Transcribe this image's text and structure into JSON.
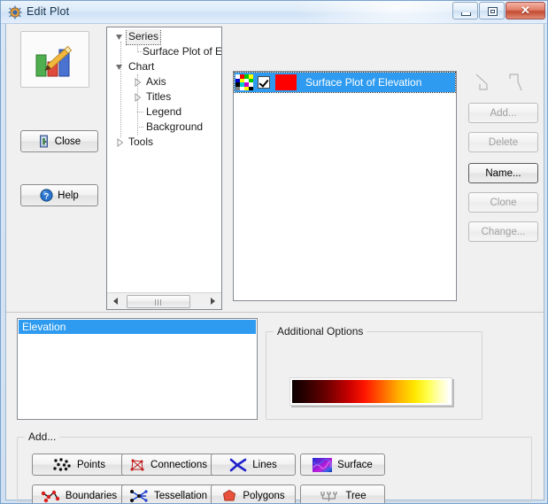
{
  "window": {
    "title": "Edit Plot",
    "icon": "plot-gear-icon",
    "controls": {
      "minimize": "minimize-button",
      "maximize": "maximize-button",
      "close": "✕"
    }
  },
  "left_panel": {
    "preview_icon": "chart-pencil-icon",
    "buttons": [
      {
        "label": "Close",
        "icon": "exit-door-icon",
        "enabled": true
      },
      {
        "label": "Help",
        "icon": "help-question-icon",
        "enabled": true
      }
    ]
  },
  "tree": {
    "nodes": [
      {
        "label": "Series",
        "level": 0,
        "state": "expanded",
        "selected": true
      },
      {
        "label": "Surface Plot of El",
        "level": 2,
        "state": "leaf",
        "selected": false
      },
      {
        "label": "Chart",
        "level": 0,
        "state": "expanded",
        "selected": false
      },
      {
        "label": "Axis",
        "level": 1,
        "state": "collapsed",
        "selected": false
      },
      {
        "label": "Titles",
        "level": 1,
        "state": "collapsed",
        "selected": false
      },
      {
        "label": "Legend",
        "level": 1,
        "state": "leaf",
        "selected": false
      },
      {
        "label": "Background",
        "level": 1,
        "state": "leaf",
        "selected": false
      },
      {
        "label": "Tools",
        "level": 0,
        "state": "collapsed",
        "selected": false
      }
    ],
    "scrollbar": {
      "left_arrow": "scroll-left-arrow-icon",
      "right_arrow": "scroll-right-arrow-icon"
    }
  },
  "series_list": {
    "rows": [
      {
        "palette_icon": "color-palette-icon",
        "visible_checked": true,
        "color_swatch": "#ff0000",
        "label": "Surface Plot of Elevation",
        "selected": true
      }
    ],
    "selection_color": "#2e9bf0"
  },
  "series_actions": {
    "move_up_icon": "move-up-arrow-icon",
    "move_down_icon": "move-down-arrow-icon",
    "buttons": [
      {
        "label": "Add...",
        "mnemonic": "A",
        "enabled": false
      },
      {
        "label": "Delete",
        "mnemonic": "D",
        "enabled": false
      },
      {
        "label": "Name...",
        "mnemonic": "N",
        "enabled": true
      },
      {
        "label": "Clone",
        "mnemonic": "C",
        "enabled": false
      },
      {
        "label": "Change...",
        "mnemonic": "h",
        "enabled": false
      }
    ]
  },
  "data_list": {
    "items": [
      {
        "label": "Elevation",
        "selected": true
      }
    ]
  },
  "additional_options": {
    "title": "Additional Options",
    "gradient": {
      "name": "hot-colormap-gradient",
      "stops": [
        "#0a0000",
        "#6d0000",
        "#c80000",
        "#ff1500",
        "#ff6a00",
        "#ffb300",
        "#ffe800",
        "#ffff4d",
        "#ffffff"
      ]
    }
  },
  "add_group": {
    "title": "Add...",
    "buttons": [
      {
        "label": "Points",
        "icon": "scatter-points-icon"
      },
      {
        "label": "Connections",
        "icon": "connections-icon"
      },
      {
        "label": "Lines",
        "icon": "lines-icon"
      },
      {
        "label": "Surface",
        "icon": "surface-texture-icon"
      },
      {
        "label": "Boundaries",
        "icon": "boundaries-icon"
      },
      {
        "label": "Tessellation",
        "icon": "tessellation-icon"
      },
      {
        "label": "Polygons",
        "icon": "polygon-icon"
      },
      {
        "label": "Tree",
        "icon": "tree-dendrogram-icon"
      }
    ]
  }
}
